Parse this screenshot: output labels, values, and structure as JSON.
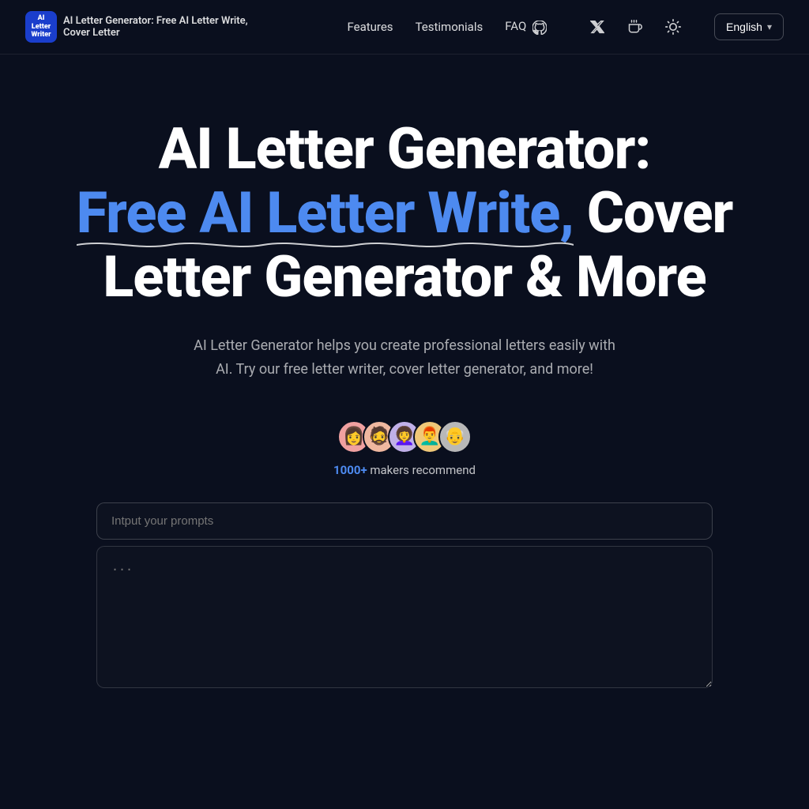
{
  "meta": {
    "page_title": "AI Letter Generator: Free AI Letter Write, Cover Letter"
  },
  "nav": {
    "logo_label": "AI\nLetter\nWriter",
    "brand_title": "AI Letter Generator: Free AI Letter Write, Cover Letter",
    "links": [
      {
        "id": "features",
        "label": "Features"
      },
      {
        "id": "testimonials",
        "label": "Testimonials"
      },
      {
        "id": "faq",
        "label": "FAQ"
      }
    ],
    "icons": {
      "github": "github-icon",
      "x": "x-icon",
      "coffee": "coffee-icon",
      "sun": "sun-icon"
    },
    "language_btn": "English",
    "language_chevron": "▾"
  },
  "hero": {
    "title_line1": "AI Letter Generator:",
    "title_line2_blue": "Free AI Letter Write,",
    "title_line2_white": " Cover",
    "title_line3": "Letter Generator & More",
    "subtitle_line1": "AI Letter Generator helps you create professional letters easily with",
    "subtitle_line2": "AI. Try our free letter writer, cover letter generator, and more!"
  },
  "social_proof": {
    "count": "1000+",
    "suffix": " makers recommend",
    "avatars": [
      "👩",
      "🧔",
      "👩‍🦱",
      "👨‍🦰",
      "👴"
    ]
  },
  "input_area": {
    "prompt_placeholder": "Intput your prompts",
    "output_placeholder": "..."
  }
}
